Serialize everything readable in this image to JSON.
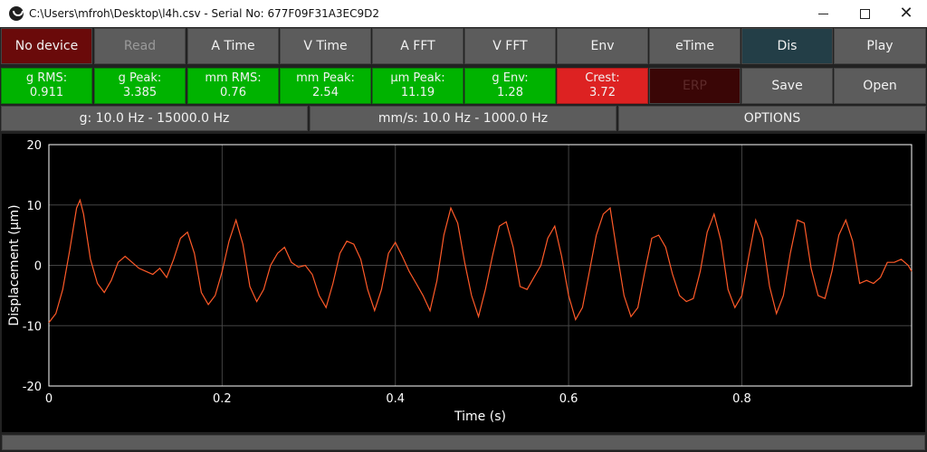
{
  "window": {
    "title": "C:\\Users\\mfroh\\Desktop\\l4h.csv - Serial No: 677F09F31A3EC9D2"
  },
  "toolbar_row1": {
    "no_device": "No device",
    "read": "Read",
    "a_time": "A Time",
    "v_time": "V Time",
    "a_fft": "A FFT",
    "v_fft": "V FFT",
    "env": "Env",
    "etime": "eTime",
    "dis": "Dis",
    "play": "Play"
  },
  "stats": {
    "g_rms": {
      "label": "g RMS:",
      "value": "0.911"
    },
    "g_peak": {
      "label": "g Peak:",
      "value": "3.385"
    },
    "mm_rms": {
      "label": "mm RMS:",
      "value": "0.76"
    },
    "mm_peak": {
      "label": "mm Peak:",
      "value": "2.54"
    },
    "um_peak": {
      "label": "µm Peak:",
      "value": "11.19"
    },
    "g_env": {
      "label": "g Env:",
      "value": "1.28"
    },
    "crest": {
      "label": "Crest:",
      "value": "3.72"
    },
    "erp": "ERP",
    "save": "Save",
    "open": "Open"
  },
  "filters": {
    "g_band": "g: 10.0 Hz - 15000.0 Hz",
    "mm_band": "mm/s: 10.0 Hz - 1000.0 Hz",
    "options": "OPTIONS"
  },
  "chart_data": {
    "type": "line",
    "xlabel": "Time (s)",
    "ylabel": "Displacement (µm)",
    "xlim": [
      0,
      0.996
    ],
    "ylim": [
      -20,
      20
    ],
    "xticks": [
      "0",
      "0.2",
      "0.4",
      "0.6",
      "0.8"
    ],
    "yticks": [
      "20",
      "10",
      "0",
      "-10",
      "-20"
    ],
    "grid": true,
    "series": [
      {
        "color": "#ff5a28",
        "x": [
          0.0,
          0.008,
          0.016,
          0.024,
          0.032,
          0.036,
          0.04,
          0.048,
          0.056,
          0.064,
          0.072,
          0.08,
          0.088,
          0.096,
          0.104,
          0.112,
          0.12,
          0.128,
          0.136,
          0.144,
          0.152,
          0.16,
          0.168,
          0.176,
          0.184,
          0.192,
          0.2,
          0.208,
          0.216,
          0.224,
          0.232,
          0.24,
          0.248,
          0.256,
          0.264,
          0.272,
          0.28,
          0.288,
          0.296,
          0.304,
          0.312,
          0.32,
          0.328,
          0.336,
          0.344,
          0.352,
          0.36,
          0.368,
          0.376,
          0.384,
          0.392,
          0.4,
          0.408,
          0.416,
          0.424,
          0.432,
          0.44,
          0.448,
          0.456,
          0.464,
          0.472,
          0.48,
          0.488,
          0.496,
          0.504,
          0.512,
          0.52,
          0.528,
          0.536,
          0.544,
          0.552,
          0.56,
          0.568,
          0.576,
          0.584,
          0.592,
          0.6,
          0.608,
          0.616,
          0.624,
          0.632,
          0.64,
          0.648,
          0.656,
          0.664,
          0.672,
          0.68,
          0.688,
          0.696,
          0.704,
          0.712,
          0.72,
          0.728,
          0.736,
          0.744,
          0.752,
          0.76,
          0.768,
          0.776,
          0.784,
          0.792,
          0.8,
          0.808,
          0.816,
          0.824,
          0.832,
          0.84,
          0.848,
          0.856,
          0.864,
          0.872,
          0.88,
          0.888,
          0.896,
          0.904,
          0.912,
          0.92,
          0.928,
          0.936,
          0.944,
          0.952,
          0.96,
          0.968,
          0.976,
          0.984,
          0.992,
          0.996
        ],
        "y": [
          -9.5,
          -8.0,
          -4.0,
          2.5,
          9.5,
          10.8,
          8.5,
          1.0,
          -3.0,
          -4.5,
          -2.5,
          0.5,
          1.5,
          0.5,
          -0.5,
          -1.0,
          -1.5,
          -0.5,
          -2.0,
          1.0,
          4.5,
          5.5,
          2.0,
          -4.5,
          -6.5,
          -5.0,
          -1.0,
          4.0,
          7.5,
          3.5,
          -3.5,
          -6.0,
          -4.0,
          0.0,
          2.0,
          3.0,
          0.5,
          -0.3,
          0.0,
          -1.5,
          -5.0,
          -7.0,
          -3.0,
          2.0,
          4.0,
          3.5,
          1.0,
          -4.0,
          -7.5,
          -4.0,
          2.0,
          3.8,
          1.5,
          -1.0,
          -3.0,
          -5.0,
          -7.5,
          -2.5,
          5.0,
          9.5,
          7.0,
          0.5,
          -5.0,
          -8.5,
          -4.0,
          1.5,
          6.5,
          7.2,
          3.0,
          -3.5,
          -4.0,
          -2.0,
          0.0,
          4.5,
          6.5,
          1.5,
          -5.0,
          -9.0,
          -7.0,
          -1.0,
          5.0,
          8.5,
          9.5,
          2.0,
          -5.0,
          -8.5,
          -7.0,
          -1.0,
          4.5,
          5.0,
          3.0,
          -1.5,
          -5.0,
          -6.0,
          -5.5,
          -1.0,
          5.5,
          8.5,
          4.0,
          -4.0,
          -7.0,
          -5.0,
          1.5,
          7.5,
          4.5,
          -3.5,
          -8.0,
          -5.0,
          2.0,
          7.5,
          7.0,
          -0.5,
          -5.0,
          -5.5,
          -1.0,
          5.0,
          7.5,
          4.0,
          -3.0,
          -2.5,
          -3.0,
          -2.0,
          0.5,
          0.5,
          1.0,
          0.0,
          -1.0
        ]
      }
    ]
  }
}
